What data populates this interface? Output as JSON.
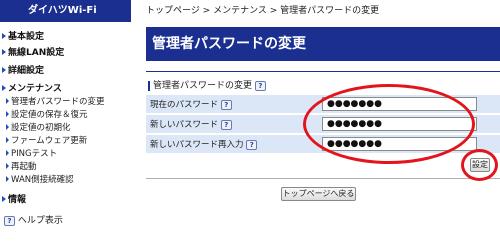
{
  "sidebar": {
    "brand": "ダイハツWi-Fi",
    "sections": [
      {
        "label": "基本設定"
      },
      {
        "label": "無線LAN設定"
      },
      {
        "label": "詳細設定"
      },
      {
        "label": "メンテナンス"
      },
      {
        "label": "情報"
      }
    ],
    "maintenance_items": [
      {
        "label": "管理者パスワードの変更"
      },
      {
        "label": "設定値の保存＆復元"
      },
      {
        "label": "設定値の初期化"
      },
      {
        "label": "ファームウェア更新"
      },
      {
        "label": "PINGテスト"
      },
      {
        "label": "再起動"
      },
      {
        "label": "WAN側接続確認"
      }
    ],
    "help_label": "ヘルプ表示",
    "help_icon_text": "?"
  },
  "main": {
    "breadcrumb": "トップページ > メンテナンス > 管理者パスワードの変更",
    "title": "管理者パスワードの変更",
    "section_heading": "管理者パスワードの変更",
    "rows": [
      {
        "label": "現在のパスワード",
        "value": "●●●●●●●"
      },
      {
        "label": "新しいパスワード",
        "value": "●●●●●●●"
      },
      {
        "label": "新しいパスワード再入力",
        "value": "●●●●●●●"
      }
    ],
    "setting_button": "設定",
    "back_button": "トップページへ戻る"
  },
  "colors": {
    "brand": "#1a2f8f",
    "row_bg": "#dbe6f7",
    "annotation": "#e3141b"
  }
}
